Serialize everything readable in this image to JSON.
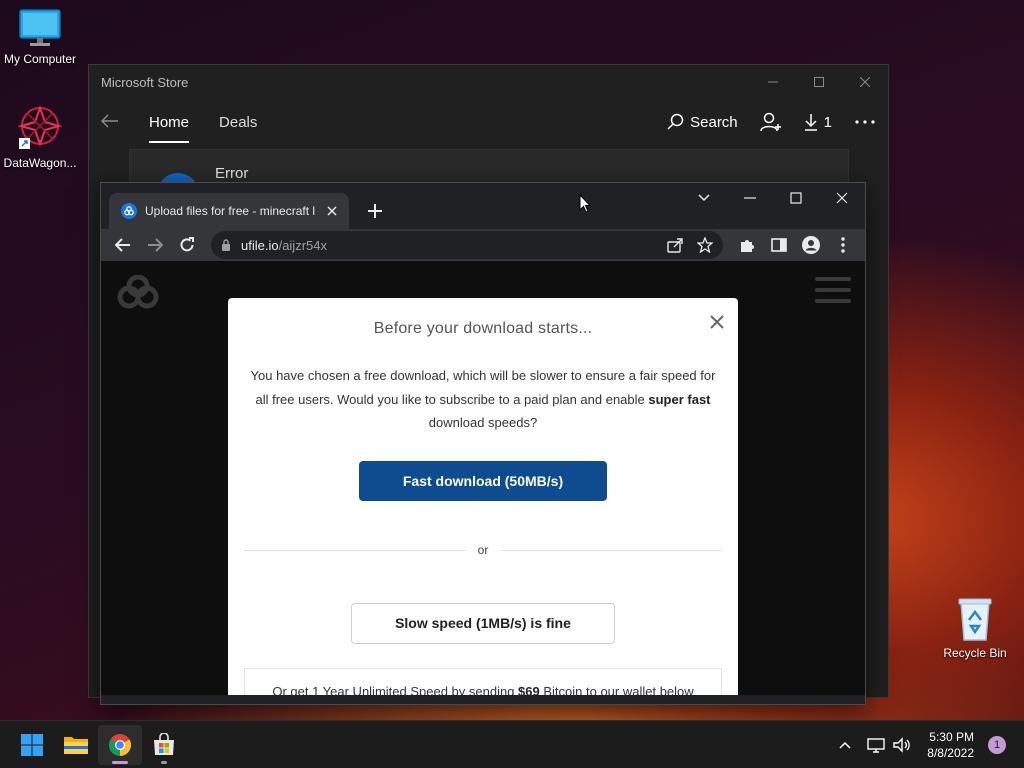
{
  "desktop": {
    "icons": [
      {
        "label": "My Computer"
      },
      {
        "label": "DataWagon..."
      },
      {
        "label": "Recycle Bin"
      }
    ]
  },
  "store": {
    "title": "Microsoft Store",
    "tabs": [
      {
        "label": "Home",
        "active": true
      },
      {
        "label": "Deals",
        "active": false
      }
    ],
    "search_label": "Search",
    "downloads_count": "1",
    "error_title": "Error"
  },
  "chrome": {
    "tab_title": "Upload files for free - minecraft l",
    "url_host": "ufile.io",
    "url_path": "/aijzr54x"
  },
  "modal": {
    "title": "Before your download starts...",
    "body_part1": "You have chosen a free download, which will be slower to ensure a fair speed for all free users. Would you like to subscribe to a paid plan and enable ",
    "body_bold": "super fast",
    "body_part2": " download speeds?",
    "fast_button": "Fast download (50MB/s)",
    "or_text": "or",
    "slow_button": "Slow speed (1MB/s) is fine",
    "bitcoin_part1": "Or get 1 Year Unlimited Speed by sending ",
    "bitcoin_bold": "$69",
    "bitcoin_part2": " Bitcoin to our wallet below",
    "fast_button_color": "#0f4c8f"
  },
  "taskbar": {
    "time": "5:30 PM",
    "date": "8/8/2022",
    "notification_count": "1",
    "apps": [
      "start-icon",
      "file-explorer-icon",
      "chrome-icon",
      "microsoft-store-icon"
    ]
  },
  "colors": {
    "accent": "#c39bd3",
    "store_bg": "#202020",
    "chrome_bg": "#202124"
  }
}
